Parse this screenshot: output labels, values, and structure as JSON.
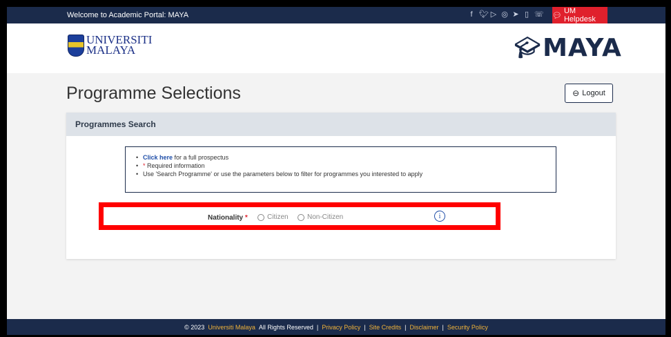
{
  "topbar": {
    "welcome": "Welcome to Academic Portal: MAYA",
    "social_icons": [
      "facebook-icon",
      "twitter-icon",
      "youtube-icon",
      "instagram-icon",
      "telegram-icon",
      "tablet-icon",
      "phone-icon"
    ],
    "helpdesk_label": "UM Helpdesk"
  },
  "header": {
    "university_line1": "UNIVERSITI",
    "university_line2": "MALAYA",
    "portal_name": "MAYA"
  },
  "page": {
    "title": "Programme Selections",
    "logout_label": "Logout"
  },
  "card": {
    "title": "Programmes Search",
    "info": {
      "link_text": "Click here",
      "link_suffix": " for a full prospectus",
      "required_marker": "*",
      "required_text": " Required information",
      "search_hint": "Use 'Search Programme' or use the parameters below to filter for programmes you interested to apply"
    },
    "nationality": {
      "label": "Nationality",
      "required_marker": "*",
      "options": [
        "Citizen",
        "Non-Citizen"
      ],
      "info_glyph": "i"
    }
  },
  "footer": {
    "copyright": "© 2023",
    "org": "Universiti Malaya",
    "rights": "All Rights Reserved",
    "separator": "|",
    "links": [
      "Privacy Policy",
      "Site Credits",
      "Disclaimer",
      "Security Policy"
    ]
  },
  "colors": {
    "navy": "#1b2b4b",
    "helpdesk_red": "#e0202c",
    "highlight_red": "#ff0000",
    "link_gold": "#f2b43a",
    "link_blue": "#1f4ea8"
  }
}
